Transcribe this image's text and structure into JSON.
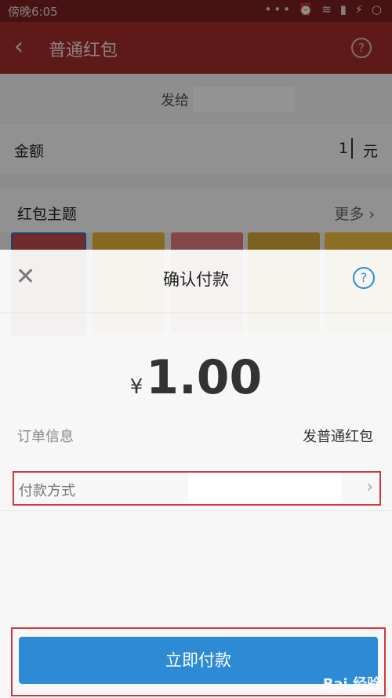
{
  "status_bar": {
    "time": "傍晚6:05",
    "icons": "••• ⏰ ≋ ▮ ⚡ ○"
  },
  "header": {
    "back": "‹",
    "title": "普通红包",
    "help": "?"
  },
  "form": {
    "to_label": "发给",
    "amount_label": "金额",
    "amount_value": "1",
    "amount_unit": "元",
    "theme_label": "红包主题",
    "theme_more": "更多 ›"
  },
  "sheet": {
    "close": "✕",
    "title": "确认付款",
    "help": "?",
    "currency_symbol": "¥",
    "amount": "1.00",
    "order_label": "订单信息",
    "order_value": "发普通红包",
    "payment_label": "付款方式",
    "payment_chevron": "›",
    "confirm_button": "立即付款"
  },
  "watermark": "Bai 经验",
  "colors": {
    "accent": "#2d8bd6",
    "header": "#a22b2b",
    "highlight": "#d23a3a"
  }
}
